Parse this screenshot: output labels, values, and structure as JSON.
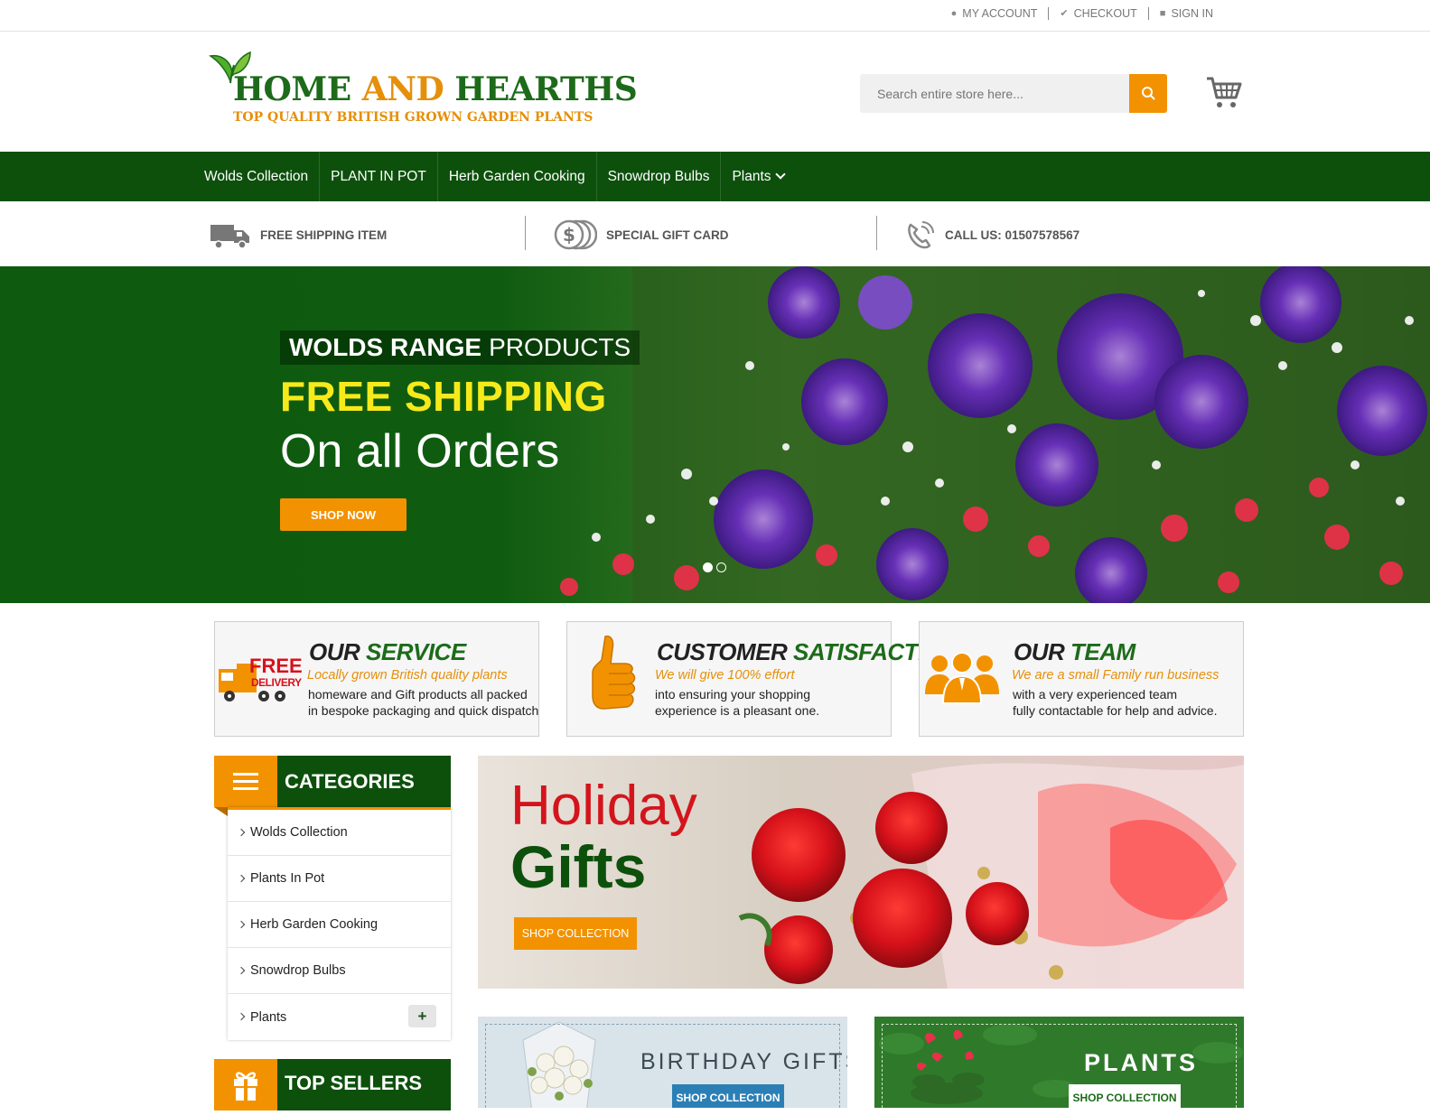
{
  "top_links": [
    {
      "icon": "user-icon",
      "label": "MY ACCOUNT"
    },
    {
      "icon": "check-icon",
      "label": "CHECKOUT"
    },
    {
      "icon": "lock-icon",
      "label": "SIGN IN"
    }
  ],
  "logo": {
    "title_a": "HOME ",
    "title_and": "AND",
    "title_b": " HEARTHS",
    "tagline": "TOP QUALITY BRITISH GROWN GARDEN PLANTS"
  },
  "search": {
    "placeholder": "Search entire store here..."
  },
  "nav": [
    "Wolds Collection",
    "PLANT IN POT",
    "Herb Garden Cooking",
    "Snowdrop Bulbs",
    "Plants"
  ],
  "features": [
    {
      "icon": "truck-icon",
      "label": "FREE SHIPPING ITEM"
    },
    {
      "icon": "coins-icon",
      "label": "SPECIAL GIFT CARD"
    },
    {
      "icon": "phone-icon",
      "label": "CALL US: 01507578567"
    }
  ],
  "hero": {
    "sub_bold": "WOLDS RANGE",
    "sub_rest": "PRODUCTS",
    "title": "FREE SHIPPING",
    "line": "On all Orders",
    "button": "SHOP NOW",
    "active_slide": 1
  },
  "services": [
    {
      "t1": "OUR",
      "t2": "SERVICE",
      "sub": "Locally grown British quality plants",
      "d1": "homeware and Gift products all packed",
      "d2": "in bespoke packaging and quick dispatch",
      "badge_a": "FREE",
      "badge_b": "DELIVERY"
    },
    {
      "t1": "CUSTOMER",
      "t2": "SATISFACTION",
      "sub": "We will give 100% effort",
      "d1": "into ensuring your shopping",
      "d2": "experience is a pleasant one."
    },
    {
      "t1": "OUR",
      "t2": "TEAM",
      "sub": "We are a small Family run business",
      "d1": "with a very experienced team",
      "d2": "fully contactable for help and advice."
    }
  ],
  "categories": {
    "title": "CATEGORIES",
    "items": [
      "Wolds Collection",
      "Plants In Pot",
      "Herb Garden Cooking",
      "Snowdrop Bulbs",
      "Plants"
    ]
  },
  "top_sellers": {
    "title": "TOP SELLERS"
  },
  "holiday": {
    "line1": "Holiday",
    "line2": "Gifts",
    "button": "SHOP COLLECTION"
  },
  "birthday": {
    "title": "BIRTHDAY GIFTS",
    "button": "SHOP COLLECTION"
  },
  "plants_banner": {
    "title": "PLANTS",
    "button": "SHOP COLLECTION"
  },
  "colors": {
    "brand_green": "#0d500c",
    "accent_orange": "#f39200",
    "hero_yellow": "#f7ea1a",
    "holiday_red": "#d4141c"
  }
}
